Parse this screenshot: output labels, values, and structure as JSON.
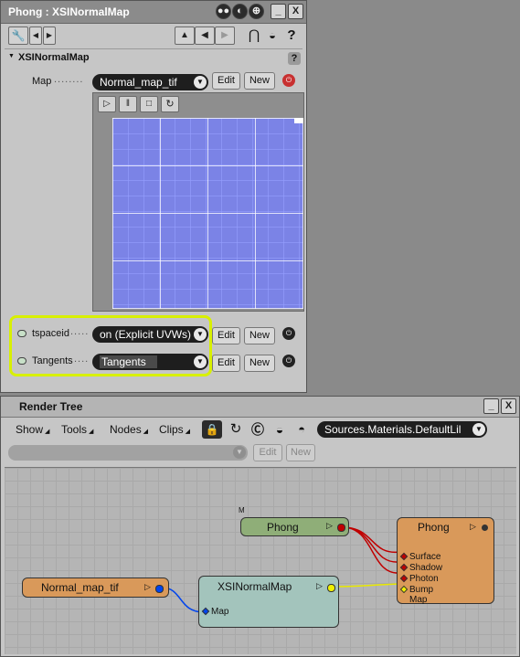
{
  "property_editor": {
    "title": "Phong : XSINormalMap",
    "title_buttons": {
      "close": "X",
      "help": "?"
    },
    "section": "XSINormalMap",
    "map": {
      "label": "Map",
      "value": "Normal_map_tif",
      "edit": "Edit",
      "new": "New"
    },
    "tspaceid": {
      "label": "tspaceid",
      "value": "on (Explicit UVWs)",
      "edit": "Edit",
      "new": "New"
    },
    "tangents": {
      "label": "Tangents",
      "value": "Tangents",
      "edit": "Edit",
      "new": "New"
    },
    "help_icon": "?"
  },
  "render_tree": {
    "title": "Render Tree",
    "window_buttons": {
      "minimize": "_",
      "close": "X"
    },
    "menus": [
      "Show",
      "Tools",
      "Nodes",
      "Clips"
    ],
    "source_combo": "Sources.Materials.DefaultLil",
    "edit": "Edit",
    "new": "New",
    "marker": "M",
    "nodes": {
      "phong_small": {
        "name": "Phong"
      },
      "phong_main": {
        "name": "Phong",
        "ports": [
          "Surface",
          "Shadow",
          "Photon",
          "Bump Map"
        ]
      },
      "normal_map": {
        "name": "Normal_map_tif"
      },
      "xsi_normal": {
        "name": "XSINormalMap",
        "ports": [
          "Map"
        ]
      }
    }
  },
  "colors": {
    "node_orange": "#d9995a",
    "node_green": "#8fae78",
    "node_teal": "#a3c4bc",
    "highlight": "#d8f000"
  }
}
